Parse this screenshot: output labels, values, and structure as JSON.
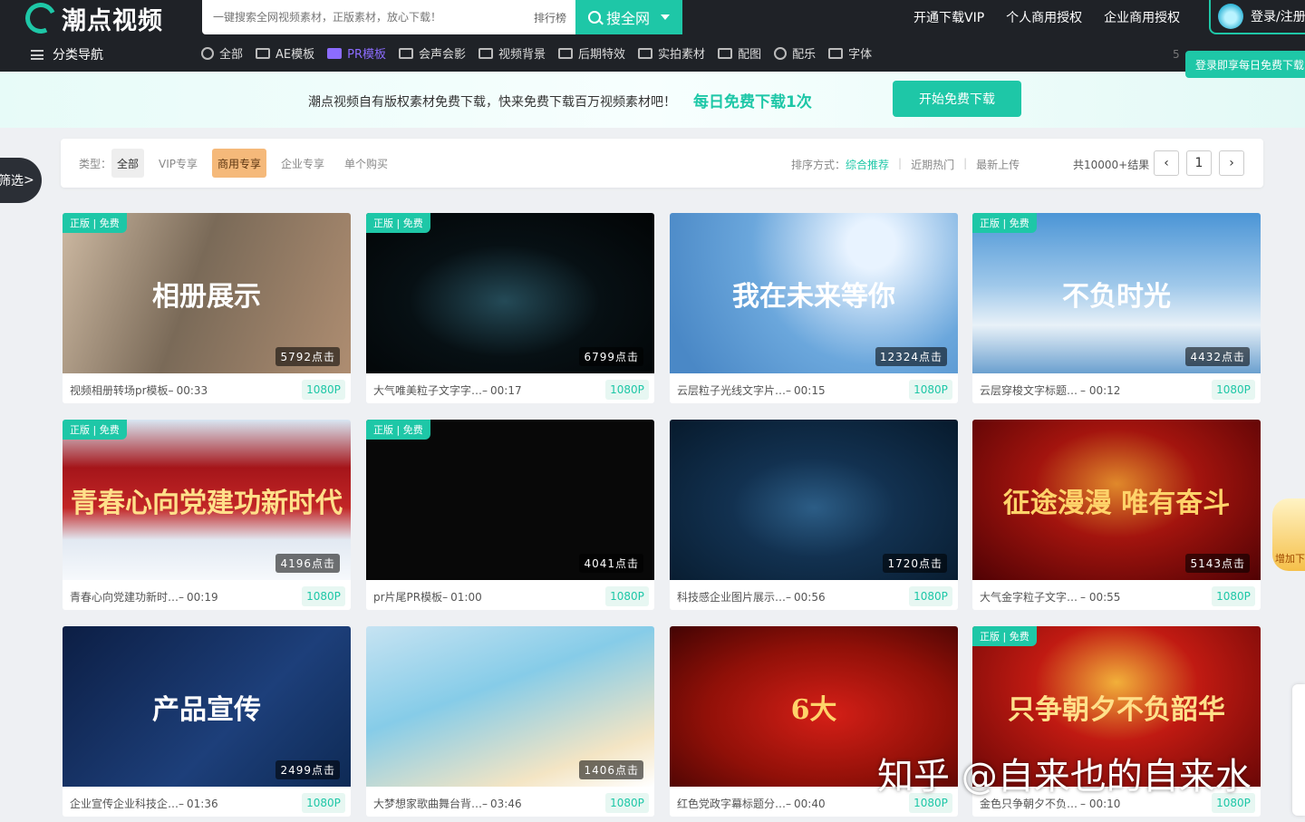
{
  "header": {
    "logo_text": "潮点视频",
    "search_placeholder": "一键搜索全网视频素材，正版素材，放心下载！",
    "rank_label": "排行榜",
    "search_button": "搜全网",
    "links": [
      "开通下载VIP",
      "个人商用授权",
      "企业商用授权"
    ],
    "login_label": "登录/注册",
    "login_tip": "登录即享每日免费下载",
    "menu_label": "分类导航",
    "side_num": "5",
    "categories": [
      {
        "label": "全部",
        "icon": "search-icon"
      },
      {
        "label": "AE模板",
        "icon": "ae-icon"
      },
      {
        "label": "PR模板",
        "icon": "pr-icon",
        "active": true
      },
      {
        "label": "会声会影",
        "icon": "vs-icon"
      },
      {
        "label": "视频背景",
        "icon": "video-bg-icon"
      },
      {
        "label": "后期特效",
        "icon": "effects-icon"
      },
      {
        "label": "实拍素材",
        "icon": "camera-icon"
      },
      {
        "label": "配图",
        "icon": "image-icon"
      },
      {
        "label": "配乐",
        "icon": "music-icon"
      },
      {
        "label": "字体",
        "icon": "font-icon"
      }
    ]
  },
  "banner": {
    "text": "潮点视频自有版权素材免费下载，快来免费下载百万视频素材吧！",
    "highlight": "每日免费下载1次",
    "button": "开始免费下载"
  },
  "filter": {
    "type_label": "类型：",
    "types": [
      "全部",
      "VIP专享",
      "商用专享",
      "企业专享",
      "单个购买"
    ],
    "sort_label": "排序方式：",
    "sorts": [
      "综合推荐",
      "近期热门",
      "最新上传"
    ],
    "total": "共10000+结果",
    "page": "1",
    "side_filter": "筛选"
  },
  "cards": [
    {
      "tag": "正版 | 免费",
      "clicks": "5792点击",
      "title": "视频相册转场pr模板–",
      "duration": "00:33",
      "res": "1080P",
      "overlay": "相册展示"
    },
    {
      "tag": "正版 | 免费",
      "clicks": "6799点击",
      "title": "大气唯美粒子文字字…–",
      "duration": "00:17",
      "res": "1080P",
      "overlay": ""
    },
    {
      "tag": "",
      "clicks": "12324点击",
      "title": "云层粒子光线文字片…–",
      "duration": "00:15",
      "res": "1080P",
      "overlay": "我在未来等你"
    },
    {
      "tag": "正版 | 免费",
      "clicks": "4432点击",
      "title": "云层穿梭文字标题…",
      "duration": "– 00:12",
      "res": "1080P",
      "overlay": "不负时光"
    },
    {
      "tag": "正版 | 免费",
      "clicks": "4196点击",
      "title": "青春心向党建功新时…–",
      "duration": "00:19",
      "res": "1080P",
      "overlay": "青春心向党建功新时代"
    },
    {
      "tag": "正版 | 免费",
      "clicks": "4041点击",
      "title": "pr片尾PR模板–",
      "duration": "01:00",
      "res": "1080P",
      "overlay": ""
    },
    {
      "tag": "",
      "clicks": "1720点击",
      "title": "科技感企业图片展示…–",
      "duration": "00:56",
      "res": "1080P",
      "overlay": ""
    },
    {
      "tag": "",
      "clicks": "5143点击",
      "title": "大气金字粒子文字…",
      "duration": "– 00:55",
      "res": "1080P",
      "overlay": "征途漫漫 唯有奋斗"
    },
    {
      "tag": "",
      "clicks": "2499点击",
      "title": "企业宣传企业科技企…–",
      "duration": "01:36",
      "res": "1080P",
      "overlay": "产品宣传"
    },
    {
      "tag": "",
      "clicks": "1406点击",
      "title": "大梦想家歌曲舞台背…–",
      "duration": "03:46",
      "res": "1080P",
      "overlay": ""
    },
    {
      "tag": "",
      "clicks": "",
      "title": "红色党政字幕标题分…–",
      "duration": "00:40",
      "res": "1080P",
      "overlay": "6大"
    },
    {
      "tag": "正版 | 免费",
      "clicks": "",
      "title": "金色只争朝夕不负…",
      "duration": "– 00:10",
      "res": "1080P",
      "overlay": "只争朝夕不负韶华"
    }
  ],
  "watermark": "知乎 @自来也的自来水",
  "float_ad": "增加下"
}
